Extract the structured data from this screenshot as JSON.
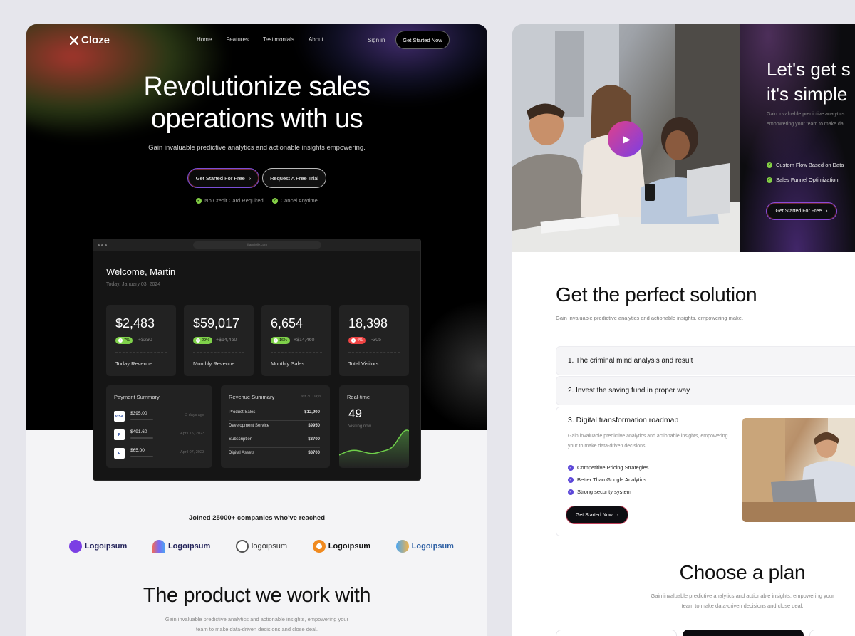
{
  "left": {
    "brand": "Cloze",
    "nav": [
      "Home",
      "Features",
      "Testimonials",
      "About"
    ],
    "sign_in": "Sign in",
    "nav_cta": "Get Started Now",
    "hero_title_1": "Revolutionize sales",
    "hero_title_2": "operations with us",
    "hero_subtitle": "Gain invaluable predictive analytics and actionable insights empowering.",
    "cta_primary": "Get Started For Free",
    "cta_secondary": "Request A Free Trial",
    "checks": [
      "No Credit Card Required",
      "Cancel Anytime"
    ],
    "dashboard": {
      "url": "franciolle.com",
      "welcome": "Welcome, Martin",
      "date": "Today, January 03, 2024",
      "stats": [
        {
          "value": "$2,483",
          "pill": "7%",
          "delta": "+$290",
          "label": "Today Revenue",
          "trend": "up"
        },
        {
          "value": "$59,017",
          "pill": "29%",
          "delta": "+$14,460",
          "label": "Monthly Revenue",
          "trend": "up"
        },
        {
          "value": "6,654",
          "pill": "16%",
          "delta": "+$14,460",
          "label": "Monthly Sales",
          "trend": "up"
        },
        {
          "value": "18,398",
          "pill": "4%",
          "delta": "-305",
          "label": "Total Visitors",
          "trend": "down"
        }
      ],
      "payment": {
        "title": "Payment Summary",
        "rows": [
          {
            "card": "VISA",
            "amount": "$395.00",
            "when": "2 days ago"
          },
          {
            "card": "P",
            "amount": "$491.60",
            "when": "April 15, 2023"
          },
          {
            "card": "P",
            "amount": "$65.00",
            "when": "April 07, 2023"
          }
        ]
      },
      "revenue": {
        "title": "Revenue Summary",
        "period": "Last 30 Days",
        "rows": [
          {
            "k": "Product Sales",
            "v": "$12,900"
          },
          {
            "k": "Development Service",
            "v": "$9950"
          },
          {
            "k": "Subscription",
            "v": "$3700"
          },
          {
            "k": "Digital Assets",
            "v": "$3700"
          }
        ]
      },
      "realtime": {
        "title": "Real-time",
        "value": "49",
        "sub": "Visiting now"
      }
    },
    "joined": "Joined 25000+ companies who've reached",
    "logos": [
      "Logoipsum",
      "Logoipsum",
      "logoipsum",
      "Logoipsum",
      "Logoipsum"
    ],
    "product_title": "The product we work with",
    "product_sub": "Gain invaluable predictive analytics and actionable insights, empowering your team to make data-driven decisions and close deal."
  },
  "right": {
    "panel_title_1": "Let's get s",
    "panel_title_2": "it's simple",
    "panel_sub_1": "Gain invaluable predictive analytics",
    "panel_sub_2": "empowering your team to make da",
    "panel_checks": [
      "Custom Flow Based on Data",
      "Sales Funnel Optimization"
    ],
    "panel_cta": "Get Started For Free",
    "solution_title": "Get the perfect solution",
    "solution_sub": "Gain invaluable predictive analytics and actionable insights, empowering make.",
    "accordion": [
      "1. The criminal mind analysis and result",
      "2. Invest the saving fund in proper way",
      "3. Digital transformation roadmap"
    ],
    "open_desc": "Gain invaluable predictive analytics and actionable insights, empowering your to make data-driven decisions.",
    "open_items": [
      "Competitive Pricing Strategies",
      "Better Than Google Analytics",
      "Strong security system"
    ],
    "open_cta": "Get Started Now",
    "plan_title": "Choose a plan",
    "plan_sub": "Gain invaluable predictive analytics and actionable insights, empowering your team to make data-driven decisions and close deal."
  },
  "colors": {
    "accent_green": "#84d046",
    "accent_purple": "#5b46d8",
    "play_gradient": "#7b3fe4"
  }
}
